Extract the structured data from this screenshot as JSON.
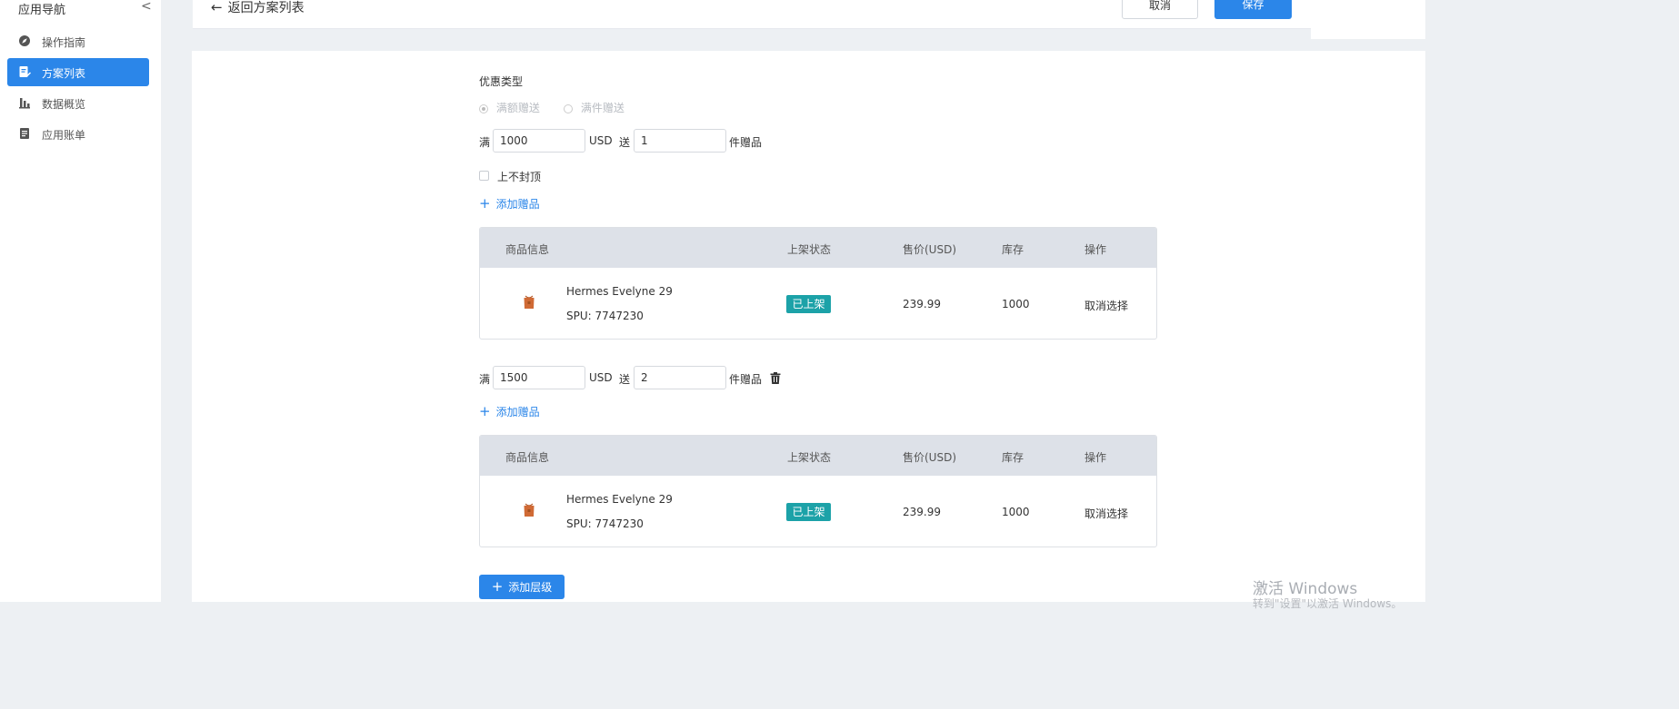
{
  "sidebar": {
    "title": "应用导航",
    "collapse_glyph": "<",
    "items": [
      {
        "label": "操作指南",
        "icon": "compass-icon"
      },
      {
        "label": "方案列表",
        "icon": "document-edit-icon",
        "active": true
      },
      {
        "label": "数据概览",
        "icon": "bar-chart-icon"
      },
      {
        "label": "应用账单",
        "icon": "bill-icon"
      }
    ]
  },
  "header": {
    "back_label": "返回方案列表",
    "cancel_label": "取消",
    "save_label": "保存"
  },
  "form": {
    "discount_type_label": "优惠类型",
    "discount_options": [
      "满额赠送",
      "满件赠送"
    ],
    "selected_option": "满额赠送",
    "man": "满",
    "usd": "USD",
    "song": "送",
    "gift_unit": "件赠品",
    "no_cap_label": "上不封顶",
    "add_gift_label": "添加赠品",
    "add_level_label": "添加层级"
  },
  "tiers": [
    {
      "amount": "1000",
      "gift_count": "1",
      "deletable": false
    },
    {
      "amount": "1500",
      "gift_count": "2",
      "deletable": true
    }
  ],
  "table": {
    "headers": [
      "商品信息",
      "上架状态",
      "售价(USD)",
      "库存",
      "操作"
    ],
    "row": {
      "name": "Hermes Evelyne 29",
      "spu": "SPU: 7747230",
      "status": "已上架",
      "price": "239.99",
      "stock": "1000",
      "action": "取消选择"
    }
  },
  "colors": {
    "accent": "#2b86e9",
    "status_badge": "#1ca2a8",
    "table_header": "#dde1e8"
  },
  "watermark": {
    "line1": "激活 Windows",
    "line2": "转到\"设置\"以激活 Windows。"
  }
}
